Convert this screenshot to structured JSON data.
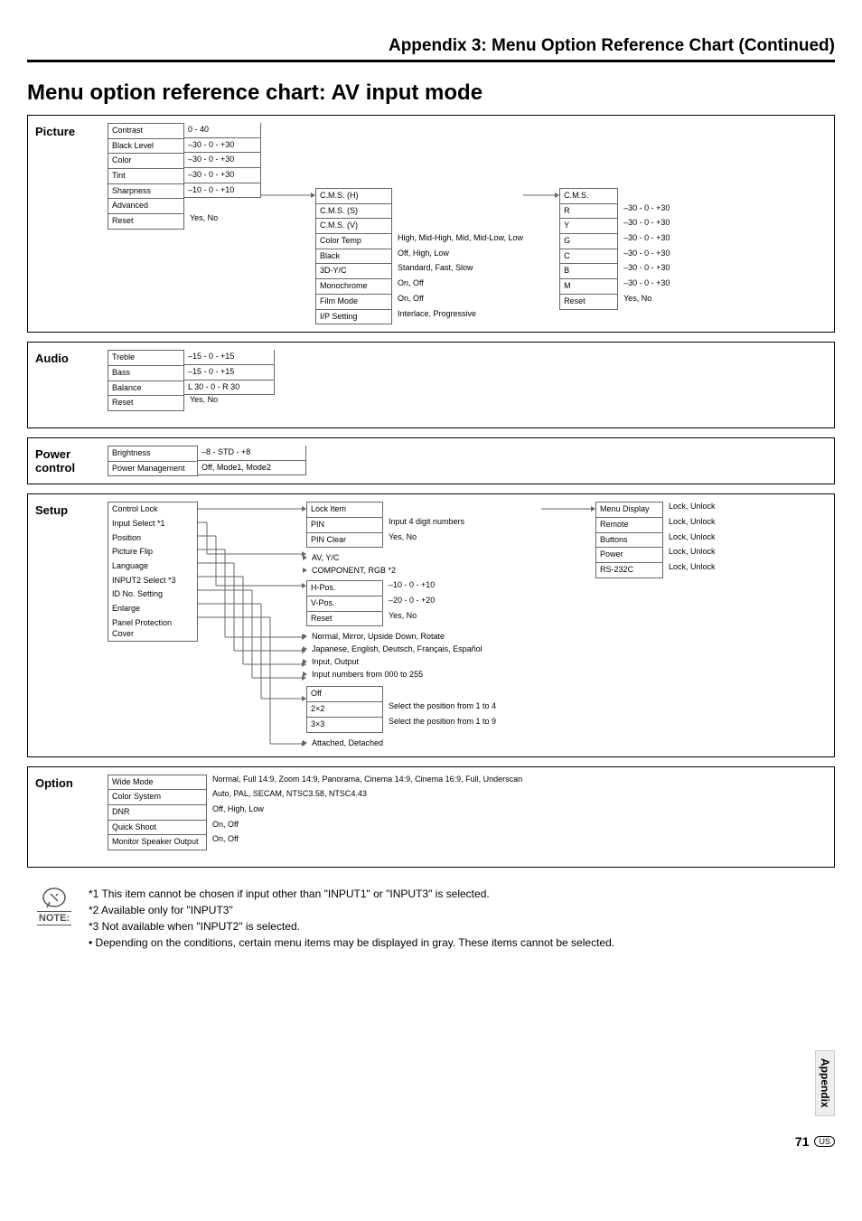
{
  "header": {
    "title": "Appendix 3: Menu Option Reference Chart (Continued)"
  },
  "subtitle": "Menu option reference chart: AV input mode",
  "picture": {
    "label": "Picture",
    "items": [
      {
        "name": "Contrast",
        "val": "0 - 40"
      },
      {
        "name": "Black Level",
        "val": "–30 - 0 - +30"
      },
      {
        "name": "Color",
        "val": "–30 - 0 - +30"
      },
      {
        "name": "Tint",
        "val": "–30 - 0 - +30"
      },
      {
        "name": "Sharpness",
        "val": "–10 - 0 - +10"
      },
      {
        "name": "Advanced",
        "val": ""
      },
      {
        "name": "Reset",
        "val": "Yes, No"
      }
    ],
    "advanced": [
      {
        "name": "C.M.S. (H)",
        "val": ""
      },
      {
        "name": "C.M.S. (S)",
        "val": ""
      },
      {
        "name": "C.M.S. (V)",
        "val": ""
      },
      {
        "name": "Color Temp",
        "val": "High, Mid-High, Mid, Mid-Low, Low"
      },
      {
        "name": "Black",
        "val": "Off, High, Low"
      },
      {
        "name": "3D-Y/C",
        "val": "Standard, Fast, Slow"
      },
      {
        "name": "Monochrome",
        "val": "On, Off"
      },
      {
        "name": "Film Mode",
        "val": "On, Off"
      },
      {
        "name": "I/P Setting",
        "val": "Interlace, Progressive"
      }
    ],
    "cms": [
      {
        "name": "C.M.S.",
        "val": ""
      },
      {
        "name": "R",
        "val": "–30 - 0 - +30"
      },
      {
        "name": "Y",
        "val": "–30 - 0 - +30"
      },
      {
        "name": "G",
        "val": "–30 - 0 - +30"
      },
      {
        "name": "C",
        "val": "–30 - 0 - +30"
      },
      {
        "name": "B",
        "val": "–30 - 0 - +30"
      },
      {
        "name": "M",
        "val": "–30 - 0 - +30"
      },
      {
        "name": "Reset",
        "val": "Yes, No"
      }
    ]
  },
  "audio": {
    "label": "Audio",
    "items": [
      {
        "name": "Treble",
        "val": "–15 - 0 - +15"
      },
      {
        "name": "Bass",
        "val": "–15 - 0 - +15"
      },
      {
        "name": "Balance",
        "val": "L 30 - 0 - R 30"
      },
      {
        "name": "Reset",
        "val": "Yes, No"
      }
    ]
  },
  "power": {
    "label1": "Power",
    "label2": "control",
    "items": [
      {
        "name": "Brightness",
        "val": "–8 - STD - +8"
      },
      {
        "name": "Power Management",
        "val": "Off, Mode1, Mode2"
      }
    ]
  },
  "setup": {
    "label": "Setup",
    "items": [
      "Control Lock",
      "Input Select *1",
      "Position",
      "Picture Flip",
      "Language",
      "INPUT2 Select *3",
      "ID No. Setting",
      "Enlarge",
      "Panel Protection Cover"
    ],
    "lock": [
      {
        "name": "Lock Item",
        "val": ""
      },
      {
        "name": "PIN",
        "val": "Input 4 digit numbers"
      },
      {
        "name": "PIN Clear",
        "val": "Yes, No"
      }
    ],
    "inputsel": [
      "AV, Y/C",
      "COMPONENT, RGB *2"
    ],
    "position": [
      {
        "name": "H-Pos.",
        "val": "–10 - 0 - +10"
      },
      {
        "name": "V-Pos.",
        "val": "–20 - 0 - +20"
      },
      {
        "name": "Reset",
        "val": "Yes, No"
      }
    ],
    "flip": "Normal, Mirror, Upside Down, Rotate",
    "lang": "Japanese, English, Deutsch, Français, Español",
    "input2": "Input, Output",
    "idno": "Input numbers from 000 to 255",
    "enlarge": [
      {
        "name": "Off",
        "val": ""
      },
      {
        "name": "2×2",
        "val": "Select the position from 1 to 4"
      },
      {
        "name": "3×3",
        "val": "Select the position from 1 to 9"
      }
    ],
    "panel": "Attached, Detached",
    "lockitems": [
      {
        "name": "Menu Display",
        "val": "Lock, Unlock"
      },
      {
        "name": "Remote",
        "val": "Lock, Unlock"
      },
      {
        "name": "Buttons",
        "val": "Lock, Unlock"
      },
      {
        "name": "Power",
        "val": "Lock, Unlock"
      },
      {
        "name": "RS-232C",
        "val": "Lock, Unlock"
      }
    ]
  },
  "option": {
    "label": "Option",
    "items": [
      {
        "name": "Wide Mode",
        "val": "Normal, Full 14:9, Zoom 14:9, Panorama, Cinema 14:9, Cinema 16:9, Full, Underscan"
      },
      {
        "name": "Color System",
        "val": "Auto, PAL, SECAM, NTSC3.58, NTSC4.43"
      },
      {
        "name": "DNR",
        "val": "Off, High, Low"
      },
      {
        "name": "Quick Shoot",
        "val": "On, Off"
      },
      {
        "name": "Monitor Speaker Output",
        "val": "On, Off"
      }
    ]
  },
  "notes": {
    "label": "NOTE:",
    "lines": [
      "*1 This item cannot be chosen if input other than \"INPUT1\" or \"INPUT3\" is selected.",
      "*2 Available only for \"INPUT3\"",
      "*3 Not available when \"INPUT2\" is selected.",
      "• Depending on the conditions, certain menu items may be displayed in gray. These items cannot be selected."
    ]
  },
  "sidebar": "Appendix",
  "footer": {
    "page": "71",
    "region": "US"
  }
}
